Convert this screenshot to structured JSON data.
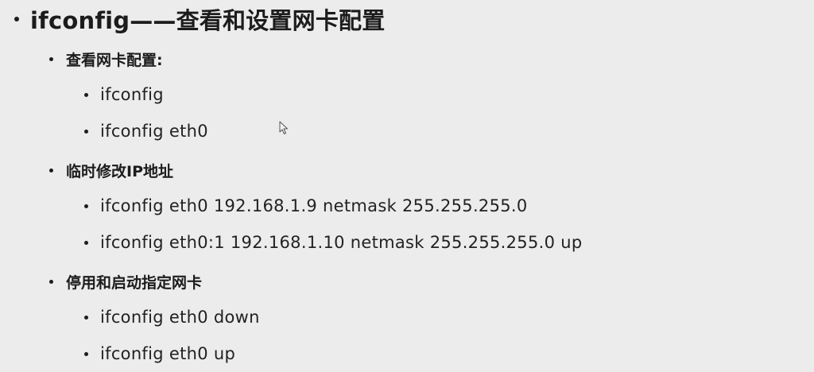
{
  "slide": {
    "title": "ifconfig——查看和设置网卡配置",
    "sections": [
      {
        "heading": "查看网卡配置:",
        "items": [
          "ifconfig",
          "ifconfig eth0"
        ]
      },
      {
        "heading": "临时修改IP地址",
        "items": [
          "ifconfig eth0 192.168.1.9 netmask 255.255.255.0",
          "ifconfig eth0:1 192.168.1.10 netmask 255.255.255.0 up"
        ]
      },
      {
        "heading": "停用和启动指定网卡",
        "items": [
          "ifconfig eth0 down",
          "ifconfig eth0 up"
        ]
      }
    ]
  },
  "colors": {
    "background": "#ececec",
    "text": "#1c1c1c"
  },
  "icons": {
    "cursor": "mouse-pointer-icon"
  }
}
